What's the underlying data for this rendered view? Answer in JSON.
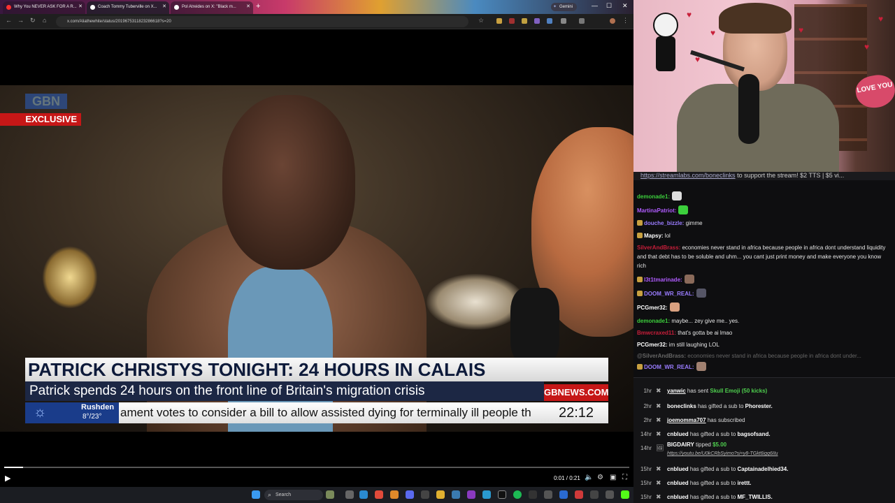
{
  "browser": {
    "tabs": [
      {
        "title": "Why You NEVER ASK FOR A R...",
        "favicon_color": "#ff3030"
      },
      {
        "title": "Coach Tommy Tuberville on X...",
        "favicon_color": "#ffffff"
      },
      {
        "title": "Pol Atreides on X: \"Black m...",
        "favicon_color": "#ffffff"
      }
    ],
    "gemini_label": "Gemini",
    "url": "x.com/Aliathewhite/status/2019675311823286618?s=20"
  },
  "video": {
    "logo_text": "GBN",
    "exclusive_label": "EXCLUSIVE",
    "headline": "PATRICK CHRISTYS TONIGHT: 24 HOURS IN CALAIS",
    "subhead": "Patrick spends 24 hours on the front line of Britain's migration crisis",
    "brand": "GBNEWS.COM",
    "weather_place": "Rushden",
    "weather_temp": "8°/23°",
    "ticker": "ament votes to consider a bill to allow assisted dying for terminally ill people th",
    "clock": "22:12"
  },
  "player": {
    "time": "0:01 / 0:21",
    "progress_fraction": 0.03
  },
  "taskbar": {
    "search_label": "Search"
  },
  "webcam": {
    "pillow_text": "LOVE YOU"
  },
  "chat": {
    "banner_link": "https://streamlabs.com/boneclinks",
    "banner_text": " to support the stream! $2 TTS | $5 vi...",
    "messages": [
      {
        "user": "demonade1:",
        "color": "#3ccf3c",
        "text": "",
        "emote": "#ddd"
      },
      {
        "user": "MartinaPatriot:",
        "color": "#b05cff",
        "text": "",
        "emote": "#3ccf3c"
      },
      {
        "user": "douche_bizzle:",
        "color": "#9a7cff",
        "text": "gimme",
        "badge": true
      },
      {
        "user": "Mapsy:",
        "color": "#ffffff",
        "text": "lol",
        "badge": true
      },
      {
        "user": "SilverAndBrass:",
        "color": "#c81e3a",
        "text": "economies never stand in africa because people in africa dont understand liquidity and that debt has to be soluble and uhm... you cant just print money and make everyone you know rich"
      },
      {
        "user": "l3t1tmarinade:",
        "color": "#b05cff",
        "text": "",
        "emote": "#8a6a5a",
        "badge": true
      },
      {
        "user": "DOOM_WR_REAL:",
        "color": "#9a7cff",
        "text": "",
        "emote": "#556",
        "badge": true
      },
      {
        "user": "PCGmer32:",
        "color": "#ffffff",
        "text": "",
        "emote": "#d9a080"
      },
      {
        "user": "demonade1:",
        "color": "#3ccf3c",
        "text": "maybe... zey give me.. yes."
      },
      {
        "user": "Bmwcraxed11:",
        "color": "#c81e3a",
        "text": "that's gotta be ai lmao"
      },
      {
        "user": "PCGmer32:",
        "color": "#ffffff",
        "text": "im still laughing LOL"
      },
      {
        "user": "@SilverAndBrass:",
        "color": "#666666",
        "text": "economies never stand in africa because people in africa dont under...",
        "faded": true
      },
      {
        "user": "DOOM_WR_REAL:",
        "color": "#9a7cff",
        "text": "",
        "emote": "#a08070",
        "badge": true
      }
    ]
  },
  "events": [
    {
      "time": "1hr",
      "name": "yanwic",
      "text": " has sent ",
      "highlight": "Skull Emoji (50 kicks)",
      "extra": ""
    },
    {
      "time": "2hr",
      "name": "boneclinks",
      "text": " has gifted a sub to ",
      "highlight": "",
      "extra": "Phorester."
    },
    {
      "time": "2hr",
      "name": "joemomma707",
      "text": " has subscribed",
      "highlight": "",
      "extra": ""
    },
    {
      "time": "14hr",
      "name": "cnblued",
      "text": " has gifted a sub to ",
      "highlight": "",
      "extra": "bagsofsand."
    },
    {
      "time": "14hr",
      "name": "BIGDAIRY",
      "text": " tipped ",
      "highlight": "$5.00",
      "extra": "",
      "link": "https://youtu.be/U0kCRbSyimo?si=y8-TGkt6igq6IIu"
    },
    {
      "time": "15hr",
      "name": "cnblued",
      "text": " has gifted a sub to ",
      "highlight": "",
      "extra": "Captainadelhied34."
    },
    {
      "time": "15hr",
      "name": "cnblued",
      "text": " has gifted a sub to ",
      "highlight": "",
      "extra": "irettt."
    },
    {
      "time": "15hr",
      "name": "cnblued",
      "text": " has gifted a sub to ",
      "highlight": "",
      "extra": "MF_TWILLIS."
    }
  ]
}
